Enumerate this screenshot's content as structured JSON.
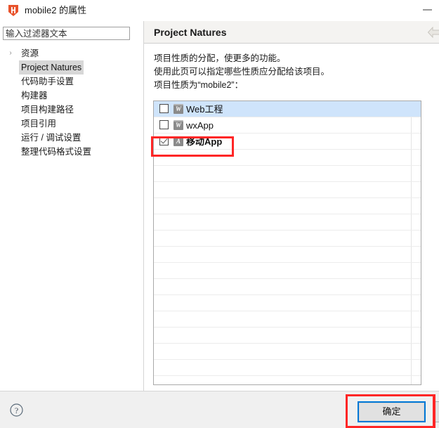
{
  "window": {
    "title": "mobile2 的属性",
    "icon": "hbuilder-app-icon",
    "minimize_label": "—"
  },
  "sidebar": {
    "filter": {
      "placeholder": "输入过滤器文本",
      "value": ""
    },
    "items": [
      {
        "label": "资源",
        "expander": "›",
        "selected": false
      },
      {
        "label": "Project Natures",
        "expander": "",
        "selected": true
      },
      {
        "label": "代码助手设置",
        "expander": "",
        "selected": false
      },
      {
        "label": "构建器",
        "expander": "",
        "selected": false
      },
      {
        "label": "项目构建路径",
        "expander": "",
        "selected": false
      },
      {
        "label": "项目引用",
        "expander": "",
        "selected": false
      },
      {
        "label": "运行 / 调试设置",
        "expander": "",
        "selected": false
      },
      {
        "label": "整理代码格式设置",
        "expander": "",
        "selected": false
      }
    ]
  },
  "page": {
    "title": "Project Natures",
    "restore_icon": "left-arrow-icon",
    "description": [
      "项目性质的分配，使更多的功能。",
      "使用此页可以指定哪些性质应分配给该项目。",
      "项目性质为“mobile2”："
    ],
    "natures": [
      {
        "label": "Web工程",
        "icon_letter": "W",
        "checked": false,
        "selected": true,
        "bold": false
      },
      {
        "label": "wxApp",
        "icon_letter": "W",
        "checked": false,
        "selected": false,
        "bold": false
      },
      {
        "label": "移动App",
        "icon_letter": "A",
        "checked": true,
        "selected": false,
        "bold": true
      }
    ],
    "empty_row_count": 15
  },
  "footer": {
    "help_label": "?",
    "ok_label": "确定"
  },
  "annotations": {
    "color": "#ff2626",
    "targets": [
      "移动App",
      "确定"
    ]
  }
}
